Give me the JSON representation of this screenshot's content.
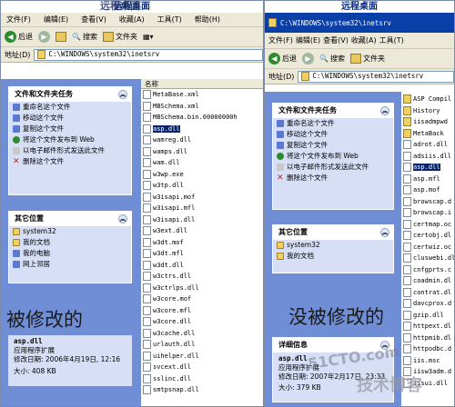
{
  "left": {
    "title": "远程桌面",
    "menu": [
      "文件(F)",
      "编辑(E)",
      "查看(V)",
      "收藏(A)",
      "工具(T)",
      "帮助(H)"
    ],
    "toolbar": {
      "back": "后退",
      "search": "搜索",
      "folders": "文件夹"
    },
    "address_label": "地址(D)",
    "address": "C:\\WINDOWS\\system32\\inetsrv",
    "tasks_title": "文件和文件夹任务",
    "tasks": [
      "重命名这个文件",
      "移动这个文件",
      "复制这个文件",
      "将这个文件发布到 Web",
      "以电子邮件形式发送此文件",
      "删除这个文件"
    ],
    "other_title": "其它位置",
    "other": [
      "system32",
      "我的文档",
      "我的电脑",
      "网上邻居"
    ],
    "detail_name": "asp.dll",
    "detail_type": "应用程序扩展",
    "detail_modified": "修改日期: 2006年4月19日, 12:16",
    "detail_size": "大小: 408 KB",
    "column": "名称",
    "files": [
      "MetaBase.xml",
      "MBSchema.xml",
      "MBSchema.bin.00000000h",
      "asp.dll",
      "wamreg.dll",
      "wamps.dll",
      "wam.dll",
      "w3wp.exe",
      "w3tp.dll",
      "w3isapi.mof",
      "w3isapi.mfl",
      "w3isapi.dll",
      "w3ext.dll",
      "w3dt.mof",
      "w3dt.mfl",
      "w3dt.dll",
      "w3ctrs.dll",
      "w3ctrlps.dll",
      "w3core.mof",
      "w3core.mfl",
      "w3core.dll",
      "w3cache.dll",
      "urlauth.dll",
      "uihelper.dll",
      "svcext.dll",
      "sslinc.dll",
      "smtpsnap.dll"
    ],
    "selected": 3,
    "caption": "被修改的"
  },
  "right": {
    "title": "远程桌面",
    "address": "C:\\WINDOWS\\system32\\inetsrv",
    "toolbar": {
      "back": "后退",
      "search": "搜索",
      "folders": "文件夹"
    },
    "tasks_title": "文件和文件夹任务",
    "tasks": [
      "重命名这个文件",
      "移动这个文件",
      "复制这个文件",
      "将这个文件发布到 Web",
      "以电子邮件形式发送此文件",
      "删除这个文件"
    ],
    "other_title": "其它位置",
    "other": [
      "system32",
      "我的文档"
    ],
    "detail_title": "详细信息",
    "detail_name": "asp.dll",
    "detail_type": "应用程序扩展",
    "detail_modified": "修改日期: 2007年2月17日, 23:33",
    "detail_size": "大小: 379 KB",
    "files": [
      "ASP Compil",
      "History",
      "iisadmpwd",
      "MetaBack",
      "adrot.dll",
      "adsiis.dll",
      "asp.dll",
      "asp.mfl",
      "asp.mof",
      "browscap.d",
      "browscap.i",
      "certmap.oc",
      "certobj.dl",
      "certwiz.oc",
      "cluswebi.dl",
      "cnfgprts.c",
      "coadmin.dl",
      "contrat.dl",
      "davcprox.d",
      "gzip.dll",
      "httpext.dl",
      "httpmib.dl",
      "httpodbc.d",
      "iis.msc",
      "iisw3adm.d",
      "iisui.dll"
    ],
    "folder_count": 4,
    "selected": 6,
    "caption": "没被修改的"
  },
  "watermark_top": "远程桌面",
  "watermark_site": "51CTO.com",
  "watermark_blog": "技术博客"
}
